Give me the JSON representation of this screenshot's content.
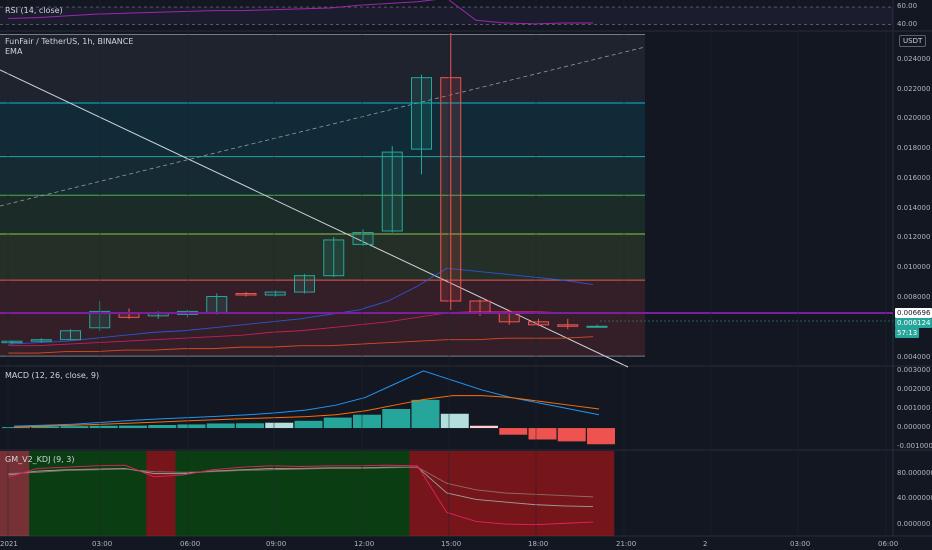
{
  "panes": {
    "rsi": {
      "title": "RSI (14, close)",
      "axis_labels": [
        "60.00",
        "40.00"
      ]
    },
    "main": {
      "title": "FunFair / TetherUS, 1h, BINANCE",
      "indicator": "EMA",
      "currency": "USDT",
      "axis_labels": [
        "0.024000",
        "0.022000",
        "0.020000",
        "0.018000",
        "0.016000",
        "0.014000",
        "0.012000",
        "0.010000",
        "0.008000",
        "0.004000"
      ],
      "price_tag": "0.006696",
      "last_price_tag": "0.006124",
      "countdown_tag": "57:13"
    },
    "macd": {
      "title": "MACD (12, 26, close, 9)",
      "axis_labels": [
        "0.003000",
        "0.002000",
        "0.001000",
        "0.000000",
        "-0.001000"
      ]
    },
    "kdj": {
      "title": "GM_V2_KDJ (9, 3)",
      "axis_labels": [
        "80.000000",
        "40.000000",
        "0.000000"
      ]
    }
  },
  "time_axis": [
    "2021",
    "03:00",
    "06:00",
    "09:00",
    "12:00",
    "15:00",
    "18:00",
    "21:00",
    "2",
    "03:00",
    "06:00"
  ],
  "colors": {
    "bg": "#131722",
    "up": "#26a69a",
    "down": "#ef5350",
    "grid": "#1e222d",
    "purple": "#7b1fa2"
  },
  "chart_data": {
    "type": "candlestick",
    "y_range": [
      0.0035,
      0.0258
    ],
    "candles": [
      {
        "o": 0.005,
        "h": 0.0051,
        "l": 0.0049,
        "c": 0.0051
      },
      {
        "o": 0.0051,
        "h": 0.0053,
        "l": 0.005,
        "c": 0.0052
      },
      {
        "o": 0.0052,
        "h": 0.0059,
        "l": 0.0052,
        "c": 0.0058
      },
      {
        "o": 0.006,
        "h": 0.0078,
        "l": 0.0058,
        "c": 0.0071
      },
      {
        "o": 0.007,
        "h": 0.0073,
        "l": 0.0066,
        "c": 0.0067
      },
      {
        "o": 0.0068,
        "h": 0.0071,
        "l": 0.0066,
        "c": 0.007
      },
      {
        "o": 0.0069,
        "h": 0.0072,
        "l": 0.0067,
        "c": 0.0071
      },
      {
        "o": 0.007,
        "h": 0.0083,
        "l": 0.0069,
        "c": 0.0081
      },
      {
        "o": 0.0083,
        "h": 0.0084,
        "l": 0.0081,
        "c": 0.0082
      },
      {
        "o": 0.0082,
        "h": 0.0085,
        "l": 0.0081,
        "c": 0.0084
      },
      {
        "o": 0.0084,
        "h": 0.0096,
        "l": 0.0083,
        "c": 0.0095
      },
      {
        "o": 0.0095,
        "h": 0.0121,
        "l": 0.0094,
        "c": 0.0119
      },
      {
        "o": 0.0116,
        "h": 0.0126,
        "l": 0.0115,
        "c": 0.0124
      },
      {
        "o": 0.0125,
        "h": 0.0182,
        "l": 0.0124,
        "c": 0.0178
      },
      {
        "o": 0.018,
        "h": 0.023,
        "l": 0.0163,
        "c": 0.0228
      },
      {
        "o": 0.0228,
        "h": 0.0258,
        "l": 0.0072,
        "c": 0.0078
      },
      {
        "o": 0.0078,
        "h": 0.0079,
        "l": 0.0068,
        "c": 0.007
      },
      {
        "o": 0.007,
        "h": 0.0072,
        "l": 0.0062,
        "c": 0.0064
      },
      {
        "o": 0.0064,
        "h": 0.0066,
        "l": 0.0061,
        "c": 0.0062
      },
      {
        "o": 0.0062,
        "h": 0.0066,
        "l": 0.0059,
        "c": 0.0061
      },
      {
        "o": 0.0061,
        "h": 0.0062,
        "l": 0.006,
        "c": 0.0061
      }
    ],
    "fib_levels": [
      {
        "price": 0.0257,
        "color": "#787b86",
        "fill": "rgba(120,123,134,0.12)"
      },
      {
        "price": 0.0211,
        "color": "#00bcd4",
        "fill": "rgba(0,188,212,0.12)"
      },
      {
        "price": 0.0175,
        "color": "#26a69a",
        "fill": "rgba(38,166,154,0.14)"
      },
      {
        "price": 0.0149,
        "color": "#4caf50",
        "fill": "rgba(76,175,80,0.14)"
      },
      {
        "price": 0.0123,
        "color": "#8bc34a",
        "fill": "rgba(139,195,74,0.14)"
      },
      {
        "price": 0.0092,
        "color": "#ef5350",
        "fill": "rgba(239,83,80,0.15)"
      },
      {
        "price": 0.0041,
        "color": "#787b86",
        "fill": "rgba(239,83,80,0.18)"
      }
    ],
    "ema_fast": [
      0.0049,
      0.005,
      0.0051,
      0.0053,
      0.0055,
      0.0057,
      0.0058,
      0.006,
      0.0062,
      0.0064,
      0.0066,
      0.0069,
      0.0072,
      0.0078,
      0.0088,
      0.01,
      0.0098,
      0.0096,
      0.0094,
      0.0092,
      0.0089
    ],
    "ema_mid": [
      0.0048,
      0.0048,
      0.0049,
      0.005,
      0.0051,
      0.0052,
      0.0053,
      0.0054,
      0.0055,
      0.0057,
      0.0058,
      0.006,
      0.0062,
      0.0064,
      0.0067,
      0.007,
      0.0071,
      0.0071,
      0.0071,
      0.007,
      0.007
    ],
    "ema_slow": [
      0.0043,
      0.0043,
      0.0044,
      0.0044,
      0.0045,
      0.0045,
      0.0046,
      0.0046,
      0.0047,
      0.0047,
      0.0048,
      0.0048,
      0.0049,
      0.005,
      0.0051,
      0.0052,
      0.0052,
      0.0053,
      0.0053,
      0.0053,
      0.0054
    ],
    "rsi": {
      "y_range": [
        34,
        68
      ],
      "levels": [
        60,
        40
      ],
      "values": [
        47,
        48,
        50,
        52,
        53,
        54,
        55,
        56,
        56,
        57,
        58,
        59,
        62,
        64,
        66,
        70,
        45,
        42,
        41,
        42,
        42
      ]
    },
    "macd": {
      "y_range": [
        -0.0011,
        0.0031
      ],
      "hist": [
        5e-05,
        8e-05,
        0.0001,
        0.00012,
        0.00013,
        0.00016,
        0.00019,
        0.00024,
        0.00025,
        0.00028,
        0.00038,
        0.00055,
        0.0007,
        0.001,
        0.00148,
        0.00075,
        0.00012,
        -0.00035,
        -0.0006,
        -0.0007,
        -0.00085
      ],
      "hist_colors": [
        "#26a69a",
        "#26a69a",
        "#26a69a",
        "#26a69a",
        "#26a69a",
        "#26a69a",
        "#26a69a",
        "#26a69a",
        "#26a69a",
        "#b2dfdb",
        "#26a69a",
        "#26a69a",
        "#26a69a",
        "#26a69a",
        "#26a69a",
        "#b2dfdb",
        "#ffcdd2",
        "#ef5350",
        "#ef5350",
        "#ef5350",
        "#ef5350"
      ],
      "macd": [
        0.0001,
        0.00015,
        0.0002,
        0.0003,
        0.0004,
        0.00048,
        0.00055,
        0.00062,
        0.0007,
        0.0008,
        0.00095,
        0.0012,
        0.0016,
        0.0023,
        0.003,
        0.0025,
        0.002,
        0.0016,
        0.0013,
        0.001,
        0.0007
      ],
      "signal": [
        5e-05,
        0.0001,
        0.00015,
        0.0002,
        0.00026,
        0.00032,
        0.00038,
        0.00044,
        0.0005,
        0.00055,
        0.0006,
        0.0007,
        0.0009,
        0.0012,
        0.0015,
        0.0017,
        0.0017,
        0.0016,
        0.0014,
        0.0012,
        0.001
      ]
    },
    "kdj": {
      "y_range": [
        -15,
        115
      ],
      "zones": [
        [
          0,
          1,
          "rgba(239,83,80,0.45)"
        ],
        [
          1,
          5,
          "rgba(0,110,0,0.45)"
        ],
        [
          5,
          6,
          "rgba(200,20,20,0.55)"
        ],
        [
          6,
          14,
          "rgba(0,110,0,0.45)"
        ],
        [
          14,
          21,
          "rgba(200,20,20,0.55)"
        ]
      ],
      "k": [
        78,
        84,
        86,
        87,
        88,
        80,
        80,
        84,
        86,
        88,
        88,
        89,
        89,
        90,
        90,
        50,
        40,
        36,
        32,
        30,
        29
      ],
      "d": [
        80,
        82,
        85,
        86,
        87,
        83,
        82,
        83,
        85,
        86,
        87,
        88,
        88,
        89,
        90,
        65,
        55,
        50,
        48,
        46,
        44
      ],
      "j": [
        74,
        88,
        90,
        92,
        93,
        75,
        78,
        86,
        90,
        92,
        91,
        92,
        92,
        93,
        92,
        20,
        6,
        2,
        1,
        3,
        5
      ]
    }
  }
}
